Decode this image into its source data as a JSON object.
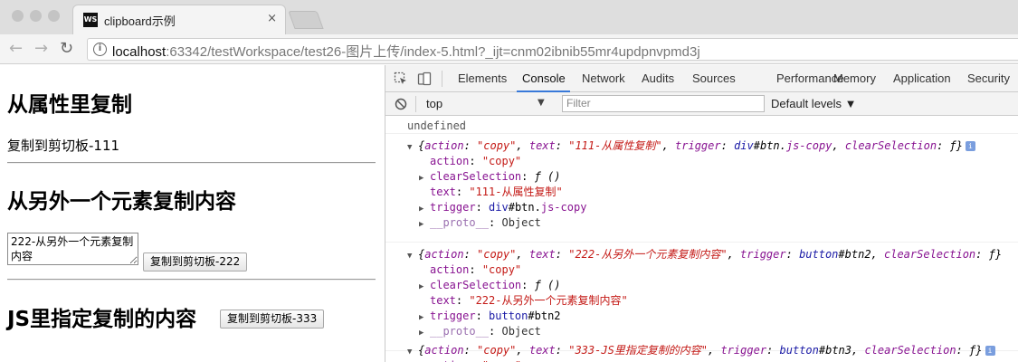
{
  "browser": {
    "tab_title": "clipboard示例",
    "tab_close": "×",
    "url_host": "localhost",
    "url_rest": ":63342/testWorkspace/test26-图片上传/index-5.html?_ijt=cnm02ibnib55mr4updpnvpmd3j"
  },
  "page": {
    "section1_heading": "从属性里复制",
    "section1_text": "复制到剪切板-111",
    "section2_heading": "从另外一个元素复制内容",
    "textarea_value": "222-从另外一个元素复制内容",
    "button2_label": "复制到剪切板-222",
    "section3_heading": "JS里指定复制的内容",
    "button3_label": "复制到剪切板-333"
  },
  "devtools": {
    "tabs": [
      "Elements",
      "Console",
      "Network",
      "Audits",
      "Sources",
      "Performance",
      "Memory",
      "Application",
      "Security"
    ],
    "active_tab": "Console",
    "context": "top",
    "filter_placeholder": "Filter",
    "levels": "Default levels ▼",
    "accent_color": "#3879d9"
  },
  "console": {
    "undefined_line": "undefined",
    "entries": [
      {
        "text": "111-从属性复制",
        "trigger": "div#btn.js-copy",
        "trigger_tag": "div",
        "trigger_rest": "#btn.",
        "trigger_class": "js-copy",
        "expanded": true
      },
      {
        "text": "222-从另外一个元素复制内容",
        "trigger": "button#btn2",
        "trigger_tag": "button",
        "trigger_rest": "#btn2",
        "trigger_class": "",
        "expanded": true
      },
      {
        "text": "333-JS里指定复制的内容",
        "trigger": "button#btn3",
        "trigger_tag": "button",
        "trigger_rest": "#btn3",
        "trigger_class": "",
        "expanded": false
      }
    ],
    "labels": {
      "action_key": "action",
      "action_value": "\"copy\"",
      "clear_key": "clearSelection",
      "clear_value": "ƒ ()",
      "text_key": "text",
      "trigger_key": "trigger",
      "proto_key": "__proto__",
      "proto_value": "Object"
    }
  }
}
